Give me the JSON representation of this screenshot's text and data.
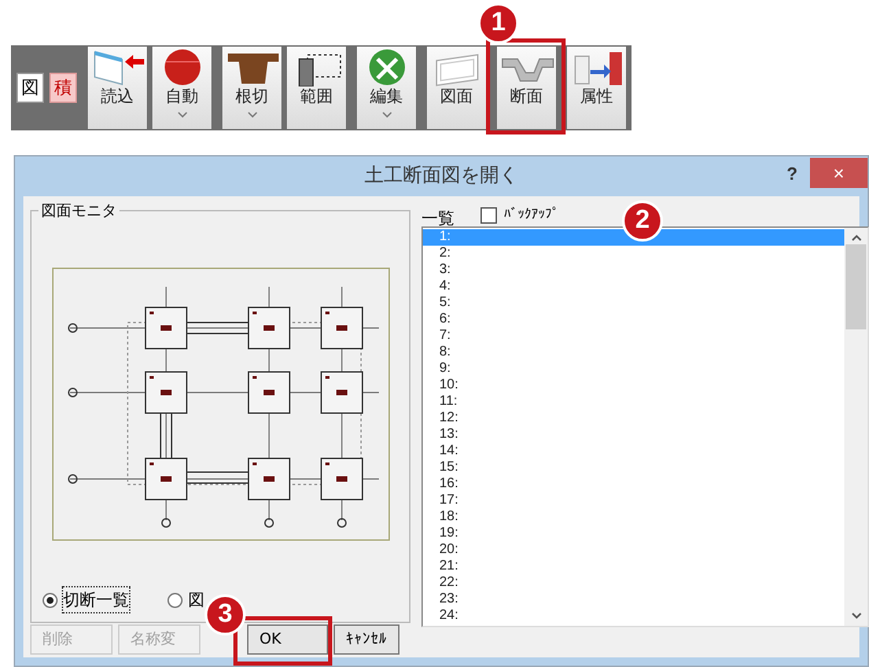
{
  "toolbar": {
    "small_buttons": [
      {
        "label": "図",
        "on": false
      },
      {
        "label": "積",
        "on": true
      }
    ],
    "buttons": [
      {
        "label": "読込",
        "dropdown": false
      },
      {
        "label": "自動",
        "dropdown": true
      },
      {
        "label": "根切",
        "dropdown": true
      },
      {
        "label": "範囲",
        "dropdown": false
      },
      {
        "label": "編集",
        "dropdown": true
      },
      {
        "label": "図面",
        "dropdown": false
      },
      {
        "label": "断面",
        "dropdown": false
      },
      {
        "label": "属性",
        "dropdown": false
      }
    ]
  },
  "callouts": [
    {
      "label": "1"
    },
    {
      "label": "2"
    },
    {
      "label": "3"
    }
  ],
  "dialog": {
    "title": "土工断面図を開く",
    "help": "?",
    "close": "×",
    "monitor": {
      "title": "図面モニタ",
      "options": [
        {
          "label": "切断一覧",
          "selected": true
        },
        {
          "label": "図",
          "selected": false
        }
      ]
    },
    "list": {
      "title": "一覧",
      "backup": {
        "label": "ﾊﾞｯｸｱｯﾌﾟ",
        "checked": false
      },
      "items": [
        {
          "label": "1:",
          "selected": true
        },
        {
          "label": "2:",
          "selected": false
        },
        {
          "label": "3:",
          "selected": false
        },
        {
          "label": "4:",
          "selected": false
        },
        {
          "label": "5:",
          "selected": false
        },
        {
          "label": "6:",
          "selected": false
        },
        {
          "label": "7:",
          "selected": false
        },
        {
          "label": "8:",
          "selected": false
        },
        {
          "label": "9:",
          "selected": false
        },
        {
          "label": "10:",
          "selected": false
        },
        {
          "label": "11:",
          "selected": false
        },
        {
          "label": "12:",
          "selected": false
        },
        {
          "label": "13:",
          "selected": false
        },
        {
          "label": "14:",
          "selected": false
        },
        {
          "label": "15:",
          "selected": false
        },
        {
          "label": "16:",
          "selected": false
        },
        {
          "label": "17:",
          "selected": false
        },
        {
          "label": "18:",
          "selected": false
        },
        {
          "label": "19:",
          "selected": false
        },
        {
          "label": "20:",
          "selected": false
        },
        {
          "label": "21:",
          "selected": false
        },
        {
          "label": "22:",
          "selected": false
        },
        {
          "label": "23:",
          "selected": false
        },
        {
          "label": "24:",
          "selected": false
        }
      ]
    },
    "buttons": [
      {
        "label": "削除",
        "disabled": true
      },
      {
        "label": "名称変",
        "disabled": true
      },
      {
        "label": "OK",
        "disabled": false
      },
      {
        "label": "ｷｬﾝｾﾙ",
        "disabled": false
      }
    ]
  }
}
